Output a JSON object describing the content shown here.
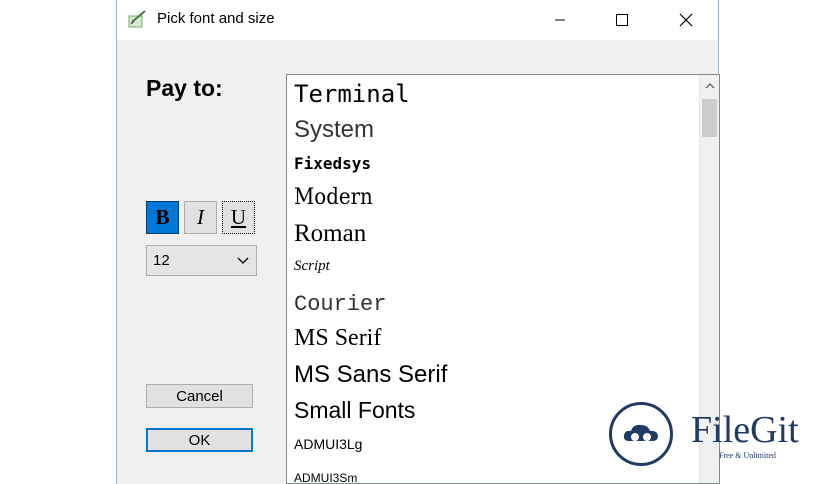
{
  "window": {
    "title": "Pick font and size",
    "icon": "font-dialog-icon",
    "controls": [
      "minimize-icon",
      "maximize-icon",
      "close-icon"
    ]
  },
  "pay_label": "Pay to:",
  "format_buttons": {
    "bold": {
      "label": "B",
      "active": true
    },
    "italic": {
      "label": "I",
      "active": false
    },
    "underline": {
      "label": "U",
      "active": false
    }
  },
  "size_select": {
    "value": "12",
    "icon": "chevron-down-icon"
  },
  "buttons": {
    "cancel": "Cancel",
    "ok": "OK"
  },
  "font_list": {
    "items": [
      "Terminal",
      "System",
      "Fixedsys",
      "Modern",
      "Roman",
      "Script",
      "Courier",
      "MS Serif",
      "MS Sans Serif",
      "Small Fonts",
      "ADMUI3Lg",
      "ADMUI3Sm"
    ]
  },
  "watermark": {
    "name": "FileGit",
    "tagline": "Free & Unlimited"
  },
  "colors": {
    "accent": "#0078d7",
    "watermark": "#1f3a63",
    "dialog_bg": "#f0f0f0"
  }
}
